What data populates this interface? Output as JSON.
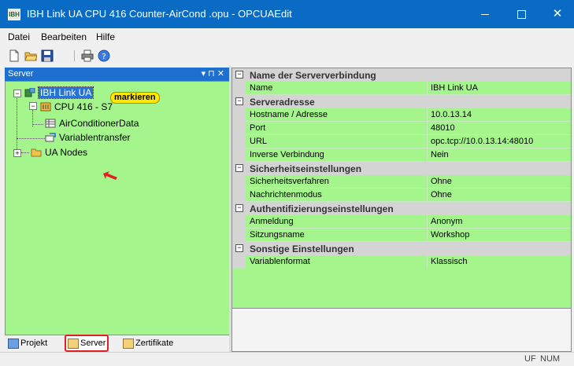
{
  "window": {
    "title": "IBH Link UA CPU 416 Counter-AirCond .opu - OPCUAEdit",
    "icon_text": "IBH"
  },
  "menu": {
    "items": [
      {
        "label": "Datei"
      },
      {
        "label": "Bearbeiten"
      },
      {
        "label": "Hilfe"
      }
    ]
  },
  "toolbar": {
    "icons": [
      "new-file-icon",
      "open-folder-icon",
      "save-icon",
      "print-icon",
      "help-icon"
    ]
  },
  "left_panel": {
    "title": "Server",
    "tools": "▾ ⊓ ✕",
    "tree": {
      "root": "IBH Link UA",
      "cpu": "CPU 416 - S7",
      "data": "AirConditionerData",
      "transfer": "Variablentransfer",
      "nodes": "UA Nodes"
    },
    "callout": "markieren",
    "tabs": {
      "project": "Projekt",
      "server": "Server",
      "certs": "Zertifikate"
    }
  },
  "properties": {
    "cat_name": {
      "title": "Name der Serververbindung",
      "rows": [
        {
          "name": "Name",
          "value": "IBH Link UA"
        }
      ]
    },
    "cat_address": {
      "title": "Serveradresse",
      "rows": [
        {
          "name": "Hostname / Adresse",
          "value": "10.0.13.14"
        },
        {
          "name": "Port",
          "value": "48010"
        },
        {
          "name": "URL",
          "value": "opc.tcp://10.0.13.14:48010"
        },
        {
          "name": "Inverse Verbindung",
          "value": "Nein"
        }
      ]
    },
    "cat_security": {
      "title": "Sicherheitseinstellungen",
      "rows": [
        {
          "name": "Sicherheitsverfahren",
          "value": "Ohne"
        },
        {
          "name": "Nachrichtenmodus",
          "value": "Ohne"
        }
      ]
    },
    "cat_auth": {
      "title": "Authentifizierungseinstellungen",
      "rows": [
        {
          "name": "Anmeldung",
          "value": "Anonym"
        },
        {
          "name": "Sitzungsname",
          "value": "Workshop"
        }
      ]
    },
    "cat_other": {
      "title": "Sonstige Einstellungen",
      "rows": [
        {
          "name": "Variablenformat",
          "value": "Klassisch"
        }
      ]
    }
  },
  "status": {
    "uf": "UF",
    "num": "NUM"
  },
  "colors": {
    "titlebar": "#0a6bc4",
    "tree_bg": "#a4f58c",
    "selection": "#2874d6",
    "callout": "#ffe800",
    "highlight": "#e02020"
  }
}
